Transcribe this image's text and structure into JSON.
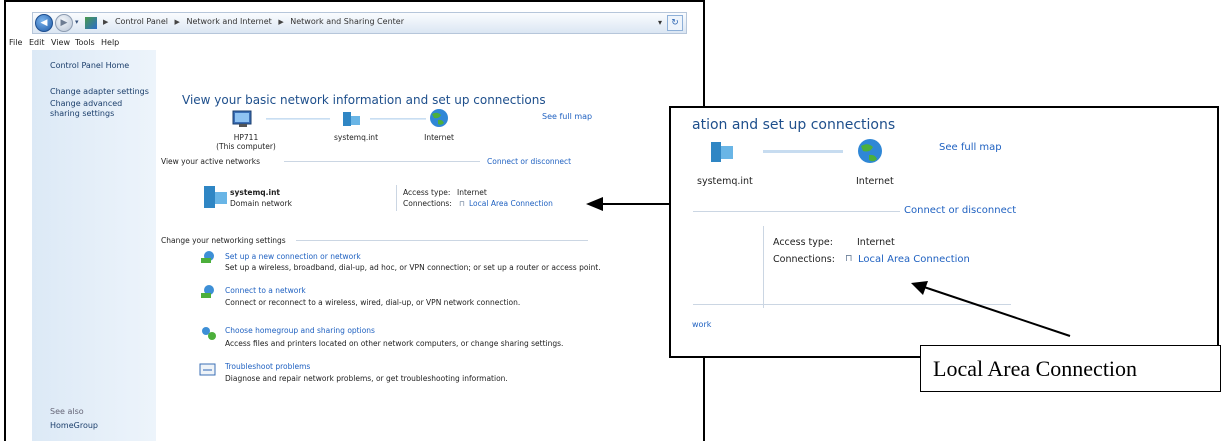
{
  "window": {
    "breadcrumb": [
      "Control Panel",
      "Network and Internet",
      "Network and Sharing Center"
    ],
    "search_icon": "refresh-search-icon"
  },
  "menu": [
    "File",
    "Edit",
    "View",
    "Tools",
    "Help"
  ],
  "sidebar": {
    "home": "Control Panel Home",
    "adapter": "Change adapter settings",
    "advanced": "Change advanced sharing settings",
    "see_also": "See also",
    "homegroup": "HomeGroup"
  },
  "main": {
    "title": "View your basic network information and set up connections",
    "full_map": "See full map",
    "computer_name": "HP711",
    "computer_sub": "(This computer)",
    "network_node": "systemq.int",
    "internet_node": "Internet",
    "active_networks": "View your active networks",
    "connect_disconnect": "Connect or disconnect",
    "network_name": "systemq.int",
    "network_type": "Domain network",
    "access_type_label": "Access type:",
    "access_type_value": "Internet",
    "connections_label": "Connections:",
    "connections_value": "Local Area Connection",
    "change_settings": "Change your networking settings",
    "tasks": [
      {
        "title": "Set up a new connection or network",
        "desc": "Set up a wireless, broadband, dial-up, ad hoc, or VPN connection; or set up a router or access point."
      },
      {
        "title": "Connect to a network",
        "desc": "Connect or reconnect to a wireless, wired, dial-up, or VPN network connection."
      },
      {
        "title": "Choose homegroup and sharing options",
        "desc": "Access files and printers located on other network computers, or change sharing settings."
      },
      {
        "title": "Troubleshoot problems",
        "desc": "Diagnose and repair network problems, or get troubleshooting information."
      }
    ]
  },
  "zoom": {
    "title": "ation and set up connections",
    "full_map": "See full map",
    "network_node": "systemq.int",
    "internet_node": "Internet",
    "connect_disconnect": "Connect or disconnect",
    "access_type_label": "Access type:",
    "access_type_value": "Internet",
    "connections_label": "Connections:",
    "connections_value": "Local Area Connection",
    "trailing": "work"
  },
  "callout": "Local Area Connection",
  "colors": {
    "link": "#1f61c1",
    "title": "#1e4f8c",
    "sidebar": "#dce9f6"
  }
}
